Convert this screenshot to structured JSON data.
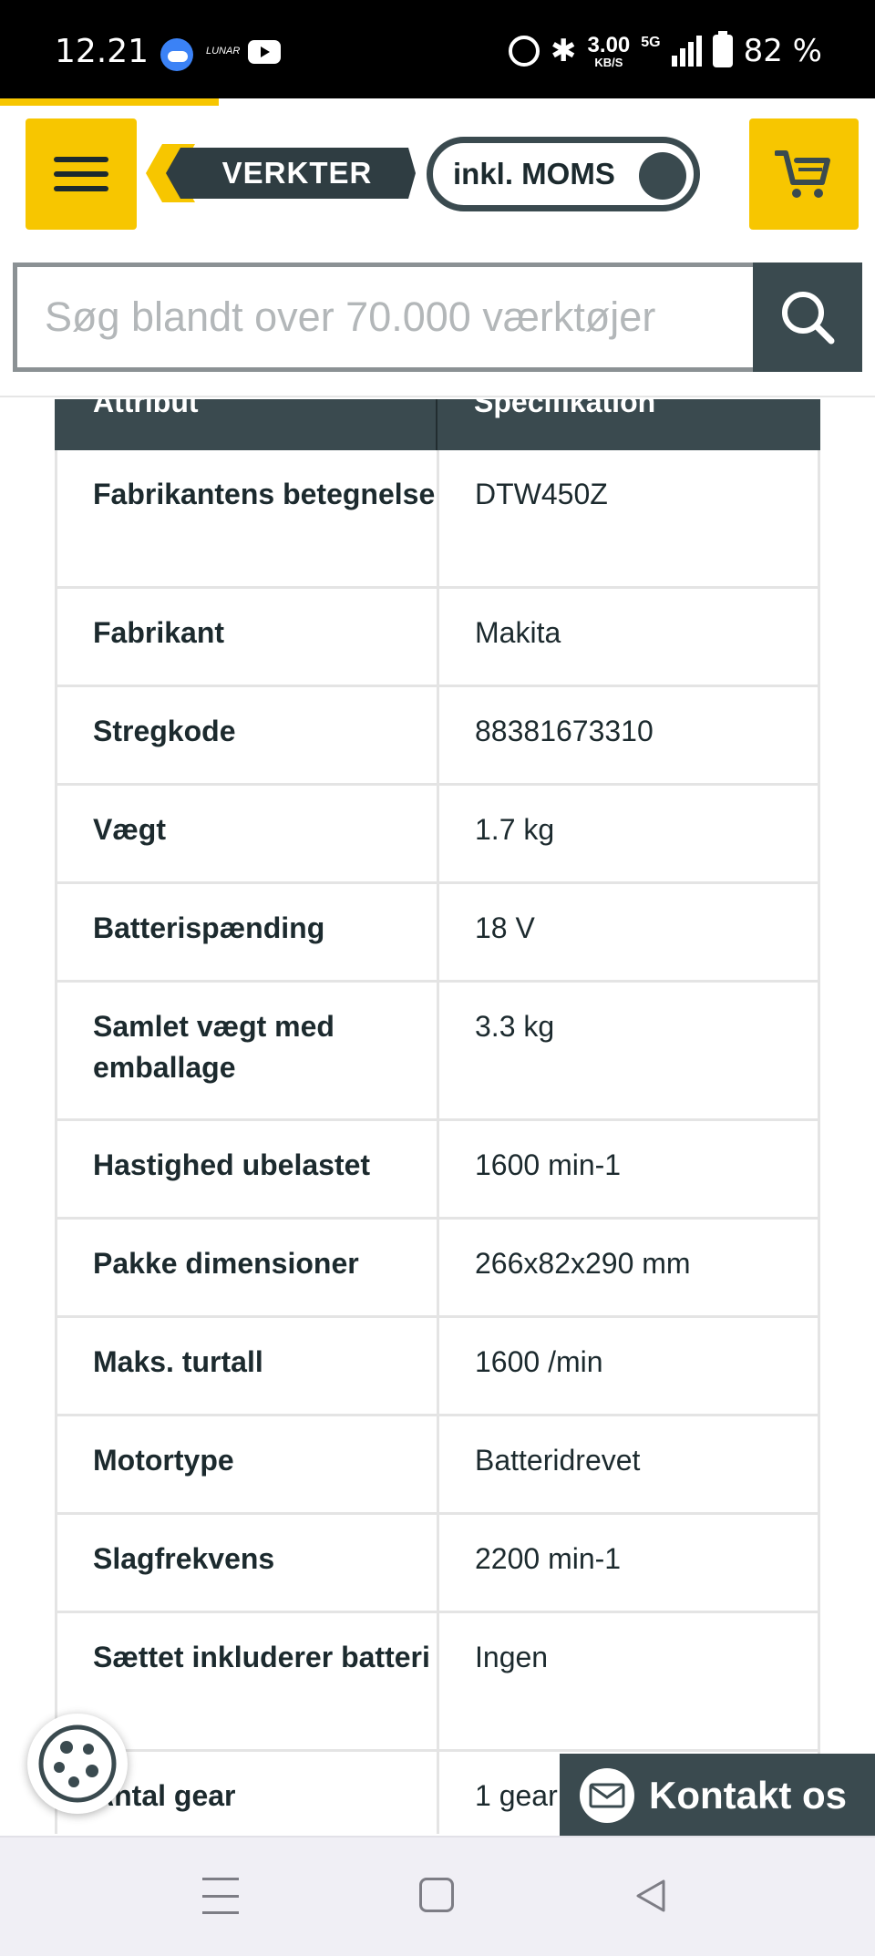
{
  "status_bar": {
    "time": "12.21",
    "lunar_label": "LUNAR",
    "speed_value": "3.00",
    "speed_unit": "KB/S",
    "network": "5G",
    "battery": "82 %"
  },
  "page_progress": 0.25,
  "header": {
    "logo_text": "VERKTER",
    "vat_toggle_label": "inkl. MOMS",
    "vat_toggle_on": true,
    "search_placeholder": "Søg blandt over 70.000 værktøjer"
  },
  "spec_table": {
    "headers": [
      "Attribut",
      "Specifikation"
    ],
    "rows": [
      {
        "attr": "Fabrikantens betegnelse",
        "spec": "DTW450Z"
      },
      {
        "attr": "Fabrikant",
        "spec": "Makita"
      },
      {
        "attr": "Stregkode",
        "spec": "88381673310"
      },
      {
        "attr": "Vægt",
        "spec": "1.7 kg"
      },
      {
        "attr": "Batterispænding",
        "spec": "18 V"
      },
      {
        "attr": "Samlet vægt med emballage",
        "spec": "3.3 kg"
      },
      {
        "attr": "Hastighed ubelastet",
        "spec": "1600 min-1"
      },
      {
        "attr": "Pakke dimensioner",
        "spec": "266x82x290 mm"
      },
      {
        "attr": "Maks. turtall",
        "spec": "1600 /min"
      },
      {
        "attr": "Motortype",
        "spec": "Batteridrevet"
      },
      {
        "attr": "Slagfrekvens",
        "spec": "2200 min-1"
      },
      {
        "attr": "Sættet inkluderer batteri",
        "spec": "Ingen"
      },
      {
        "attr": "Antal gear",
        "spec": "1 gear"
      }
    ]
  },
  "contact_button": {
    "label": "Kontakt os"
  },
  "colors": {
    "brand_yellow": "#f7c600",
    "brand_dark": "#3a4a4f",
    "text_dark": "#1c2a2e"
  },
  "icons": [
    "menu-icon",
    "cart-icon",
    "search-icon",
    "cookie-icon",
    "mail-icon",
    "nav-recents-icon",
    "nav-home-icon",
    "nav-back-icon"
  ]
}
